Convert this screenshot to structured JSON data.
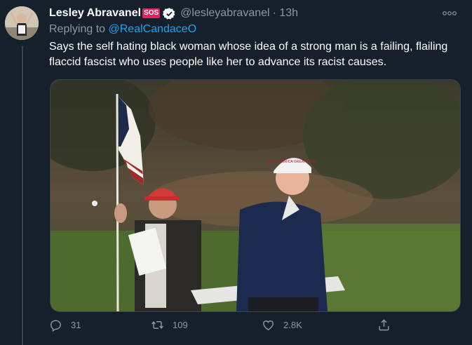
{
  "tweet": {
    "author_name": "Lesley Abravanel",
    "sos_badge": "SOS",
    "handle": "@lesleyabravanel",
    "time": "· 13h",
    "replying_prefix": "Replying to",
    "replying_to": "@RealCandaceO",
    "text": "Says the self hating black woman whose idea of a strong man is a failing, flailing flaccid fascist who uses people like her to advance its racist causes.",
    "media_hat_text": "MAKE AMERICA GREAT AGAIN"
  },
  "actions": {
    "replies": "31",
    "retweets": "109",
    "likes": "2.8K"
  },
  "colors": {
    "background": "#15202b",
    "accent": "#1da1f2",
    "muted": "#8899a6"
  }
}
